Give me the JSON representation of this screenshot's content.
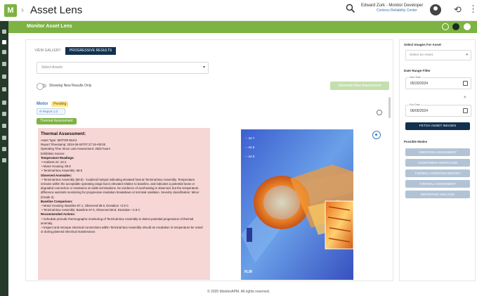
{
  "app": {
    "logo": "M",
    "title": "Asset Lens"
  },
  "user": {
    "name": "Edward Zurk - Monitor Developer",
    "org": "Contoso Reliability Center"
  },
  "module": {
    "title": "Monitor Asset Lens"
  },
  "tabs": [
    {
      "label": "VIEW GALLERY"
    },
    {
      "label": "PROGRESSIVE RESULTS"
    }
  ],
  "select_asset": {
    "value": "Select Assets"
  },
  "toggle": {
    "label": "Showing New Results Only"
  },
  "generate_button": {
    "label": "Generate New Assessment"
  },
  "asset": {
    "name": "Motor",
    "status": "Pending",
    "report_label": "Report 1.0",
    "chip_label": "Thermal Assessment"
  },
  "assessment": {
    "title": "Thermal Assessment:",
    "lines": [
      "Asset Type: MOTOR-BLK2",
      "Report Timestamp: 2024-06-04T07:27:15+00:00",
      "Operating Time Since Last Assessment: 2602 hours",
      "Exhibition Source:"
    ],
    "temp_heading": "Temperature Readings:",
    "temps": [
      "Ambient Air: 22.2",
      "Motor Housing: 89.9",
      "Terminal Box Assembly: 68.8"
    ],
    "anomalies_heading": "Observed Anomalies:",
    "anomaly_text": "Terminal Box Assembly (68.8) - localized hotspot indicating elevated heat at Terminal Box Assembly. Temperature remains within the acceptable operating range but is elevated relative to baseline, and indicates a potential loose or degraded connection or resistance at cable terminations. No evidence of overheating is observed, but the temperature difference warrants monitoring for progressive insulation breakdown or terminal oxidation. Severity classification: Minor (Grade 2).",
    "baseline_heading": "Baseline Comparison:",
    "baselines": [
      "Motor Housing: Baseline 87.1, Observed 89.9, Deviation +2.8 C",
      "Terminal Box Assembly: Baseline 67.0, Observed 68.8, Deviation +1.8 C"
    ],
    "actions_heading": "Recommended Actions:",
    "actions": [
      "Schedule periodic thermographic monitoring of Terminal Box Assembly to detect potential progression of thermal anomaly.",
      "Inspect and retorque electrical connections within Terminal Box Assembly should an escalation in temperature be noted or during planned electrical maintenance."
    ]
  },
  "thermal_image": {
    "readouts": [
      "-- 44.7",
      "-- 44.8",
      "-- 44.9"
    ],
    "brand": "FLIR"
  },
  "right_panel": {
    "head": "Select Images For Asset",
    "asset_select": "Select an Asset",
    "date_head": "Date Range Filter",
    "start_caption": "Start Date",
    "start_date": "05/20/2024",
    "end_caption": "End Date",
    "end_date": "06/05/2024",
    "fetch_label": "FETCH ASSET IMAGES",
    "results_head": "Possible Modes",
    "mode_buttons": [
      "VIBRATION ASSESSMENT",
      "COMPONENT INSPECTION",
      "THERMAL CONDITION REPORT",
      "THERMAL ASSESSMENT",
      "REPORTING ANALYSIS"
    ]
  },
  "footer": {
    "text": "© 2025 MonitorAPM. All rights reserved."
  },
  "colors": {
    "brand_green": "#7cb342",
    "navy": "#12314f",
    "nav_dark": "#263a2b",
    "card_pink": "#f7d6d6"
  }
}
